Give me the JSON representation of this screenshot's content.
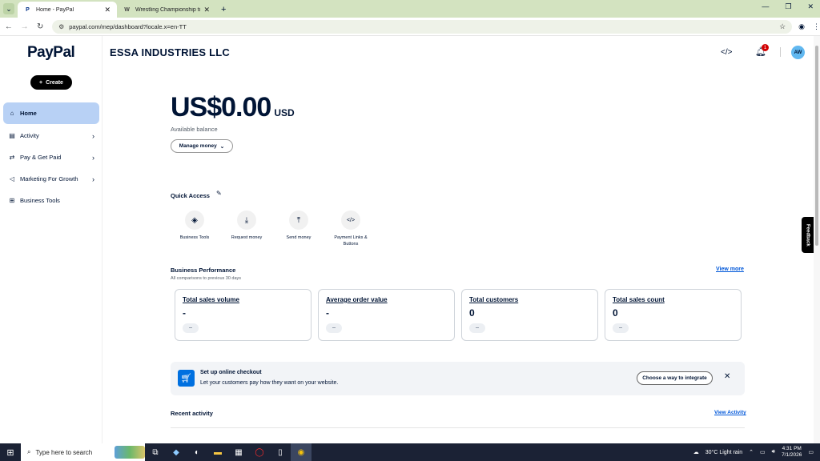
{
  "browser": {
    "tabs": [
      {
        "title": "Home - PayPal",
        "favicon": "P"
      },
      {
        "title": "Wrestling Championship title b",
        "favicon": "W"
      }
    ],
    "url": "paypal.com/mep/dashboard?locale.x=en-TT"
  },
  "sidebar": {
    "logo": "PayPal",
    "create_label": "Create",
    "items": [
      {
        "label": "Home"
      },
      {
        "label": "Activity"
      },
      {
        "label": "Pay & Get Paid"
      },
      {
        "label": "Marketing For Growth"
      },
      {
        "label": "Business Tools"
      }
    ]
  },
  "header": {
    "company": "ESSA INDUSTRIES LLC",
    "notification_count": "1",
    "avatar_initials": "AW"
  },
  "balance": {
    "amount": "US$0.00",
    "currency": "USD",
    "label": "Available balance",
    "manage_label": "Manage money"
  },
  "quick_access": {
    "title": "Quick Access",
    "items": [
      {
        "label": "Business Tools",
        "icon": "layers-icon"
      },
      {
        "label": "Request money",
        "icon": "request-money-icon"
      },
      {
        "label": "Send money",
        "icon": "send-money-icon"
      },
      {
        "label": "Payment Links & Buttons",
        "icon": "code-icon"
      }
    ]
  },
  "performance": {
    "title": "Business Performance",
    "subtitle": "All comparisons to previous 30 days",
    "view_more": "View more",
    "cards": [
      {
        "title": "Total sales volume",
        "value": "-",
        "change": "--"
      },
      {
        "title": "Average order value",
        "value": "-",
        "change": "--"
      },
      {
        "title": "Total customers",
        "value": "0",
        "change": "--"
      },
      {
        "title": "Total sales count",
        "value": "0",
        "change": "--"
      }
    ]
  },
  "checkout": {
    "heading": "Set up online checkout",
    "subtext": "Let your customers pay how they want on your website.",
    "button": "Choose a way to integrate"
  },
  "recent": {
    "title": "Recent activity",
    "link": "View Activity"
  },
  "feedback_label": "Feedback",
  "taskbar": {
    "search_placeholder": "Type here to search",
    "weather": "30°C  Light rain",
    "time": "4:31 PM",
    "date": "7/1/2026"
  }
}
